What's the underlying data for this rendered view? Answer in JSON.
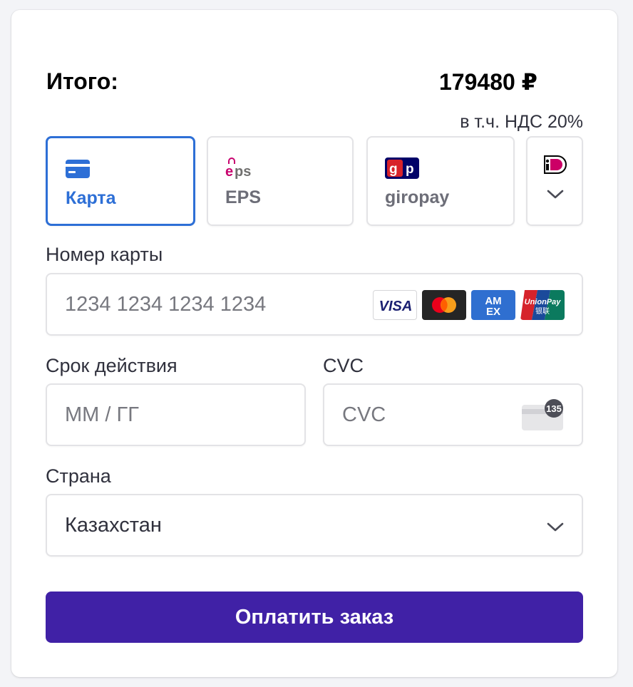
{
  "summary": {
    "total_label": "Итого:",
    "total_amount": "179480 ₽",
    "vat_note": "в т.ч. НДС 20%"
  },
  "payment_methods": [
    {
      "label": "Карта",
      "icon": "card-icon",
      "active": true
    },
    {
      "label": "EPS",
      "icon": "eps-logo",
      "active": false
    },
    {
      "label": "giropay",
      "icon": "giropay-logo",
      "active": false
    },
    {
      "label": "",
      "icon": "ideal-logo",
      "active": false
    }
  ],
  "card_number": {
    "label": "Номер карты",
    "placeholder": "1234 1234 1234 1234",
    "brands": [
      "VISA",
      "Mastercard",
      "American Express",
      "UnionPay"
    ]
  },
  "expiry": {
    "label": "Срок действия",
    "placeholder": "ММ / ГГ"
  },
  "cvc": {
    "label": "CVC",
    "placeholder": "CVC",
    "badge": "135"
  },
  "country": {
    "label": "Страна",
    "value": "Казахстан"
  },
  "submit": {
    "label": "Оплатить заказ"
  },
  "colors": {
    "accent": "#2d6fd6",
    "button": "#4021a6",
    "border": "#e3e3e6"
  }
}
